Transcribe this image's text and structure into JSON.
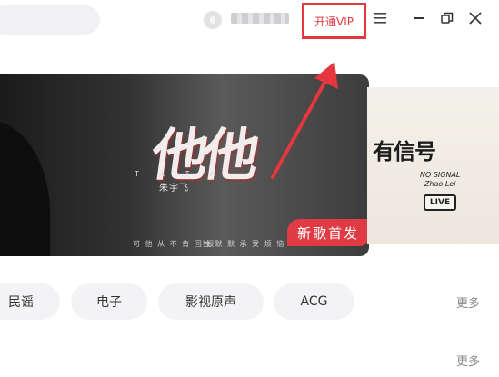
{
  "header": {
    "vip_label": "开通VIP",
    "menu_icon": "menu-icon",
    "window_controls": [
      "minimize-icon",
      "restore-icon",
      "close-icon"
    ]
  },
  "banner": {
    "title_art": "他他",
    "title_latin": "T A T A",
    "singer": "朱宇飞",
    "lyric_left": "可 他 从 不 肯 回 报",
    "lyric_right": "独 默 默 承 受 烦 恼",
    "badge": "新歌首发"
  },
  "banner_next": {
    "title": "有信号",
    "subtitle_line1": "NO SIGNAL",
    "subtitle_line2": "Zhao Lei",
    "live_label": "LIVE"
  },
  "categories": [
    "民谣",
    "电子",
    "影视原声",
    "ACG"
  ],
  "more_label": "更多",
  "colors": {
    "accent": "#e4383e",
    "pill_bg": "#f3f3f5"
  }
}
